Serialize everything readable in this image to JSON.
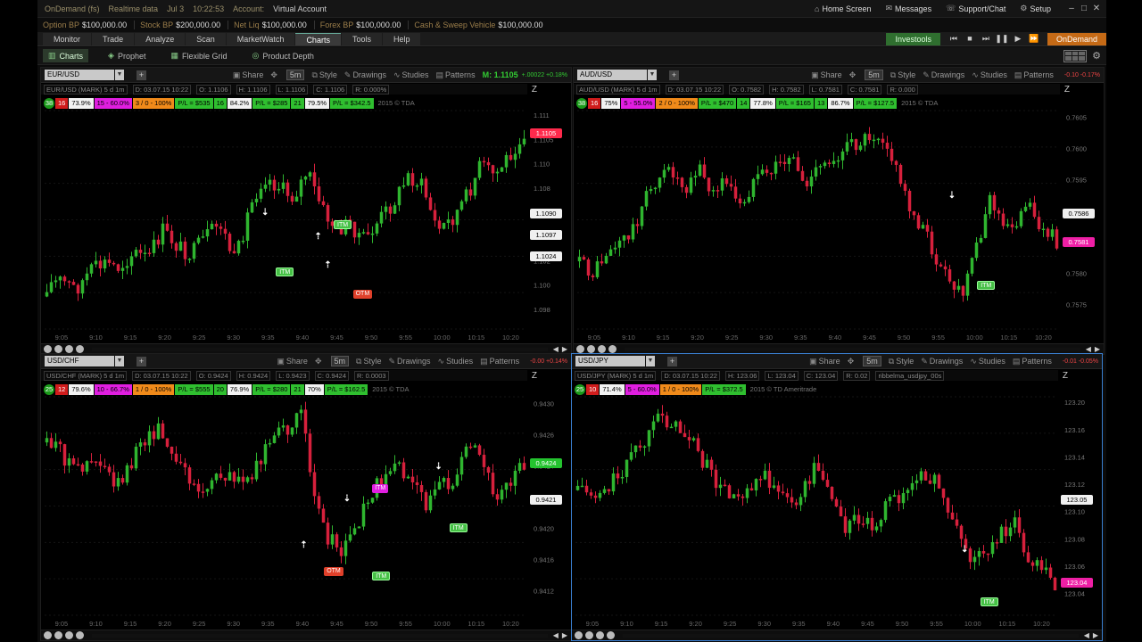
{
  "titlebar": {
    "app": "OnDemand (fs)",
    "data_mode": "Realtime data",
    "date": "Jul 3",
    "time": "10:22:53",
    "account_label": "Account:",
    "account": "Virtual Account",
    "home": "Home Screen",
    "messages": "Messages",
    "support": "Support/Chat",
    "setup": "Setup"
  },
  "account_bar": [
    {
      "label": "Option BP",
      "value": "$100,000.00"
    },
    {
      "label": "Stock BP",
      "value": "$200,000.00"
    },
    {
      "label": "Net Liq",
      "value": "$100,000.00"
    },
    {
      "label": "Forex BP",
      "value": "$100,000.00"
    },
    {
      "label": "Cash & Sweep Vehicle",
      "value": "$100,000.00"
    }
  ],
  "nav": {
    "tabs": [
      "Monitor",
      "Trade",
      "Analyze",
      "Scan",
      "MarketWatch",
      "Charts",
      "Tools",
      "Help"
    ],
    "active": "Charts",
    "live_label": "Investools",
    "ondemand_label": "OnDemand"
  },
  "subnav": [
    "Charts",
    "Prophet",
    "Flexible Grid",
    "Product Depth"
  ],
  "panel_tools": {
    "share": "Share",
    "style": "Style",
    "drawings": "Drawings",
    "studies": "Studies",
    "patterns": "Patterns",
    "period": "5m"
  },
  "panels": [
    {
      "symbol": "EUR/USD",
      "quote": "M: 1.1105",
      "quote_color": "green",
      "change": "+.00022 +0.18%",
      "info": [
        "EUR/USD (MARK) 5 d 1m",
        "D: 03.07.15 10:22",
        "O: 1.1106",
        "H: 1.1106",
        "L: 1.1106",
        "C: 1.1106",
        "R: 0.000%"
      ],
      "strip": [
        {
          "t": "38",
          "c": "g"
        },
        {
          "t": "16",
          "c": "r"
        },
        {
          "t": "73.9%",
          "c": "w"
        },
        {
          "t": "15 - 60.0%",
          "c": "m"
        },
        {
          "t": "3 / 0 - 100%",
          "c": "o"
        },
        {
          "t": "P/L = $535",
          "c": "g"
        },
        {
          "t": "16",
          "c": "g"
        },
        {
          "t": "84.2%",
          "c": "w"
        },
        {
          "t": "P/L = $285",
          "c": "g"
        },
        {
          "t": "21",
          "c": "g"
        },
        {
          "t": "79.5%",
          "c": "w"
        },
        {
          "t": "P/L = $342.5",
          "c": "g"
        }
      ],
      "note": "2015 © TDA",
      "price_tag": "1.1105",
      "levels": [
        "1.1090",
        "1.1097",
        "1.1024"
      ],
      "axis": [
        "1.111",
        "1.1105",
        "1.110",
        "1.108",
        "1.106",
        "1.104",
        "1.102",
        "1.100",
        "1.098"
      ],
      "times": [
        "9:05",
        "9:10",
        "9:15",
        "9:20",
        "9:25",
        "9:30",
        "9:35",
        "9:40",
        "9:45",
        "9:50",
        "9:55",
        "10:00",
        "10:15",
        "10:20"
      ]
    },
    {
      "symbol": "AUD/USD",
      "quote": "",
      "quote_color": "red",
      "change": "-0.10 -0.17%",
      "info": [
        "AUD/USD (MARK) 5 d 1m",
        "D: 03.07.15 10:22",
        "O: 0.7582",
        "H: 0.7582",
        "L: 0.7581",
        "C: 0.7581",
        "R: 0.000"
      ],
      "strip": [
        {
          "t": "38",
          "c": "g"
        },
        {
          "t": "16",
          "c": "r"
        },
        {
          "t": "75%",
          "c": "w"
        },
        {
          "t": "5 - 55.0%",
          "c": "m"
        },
        {
          "t": "2 / 0 - 100%",
          "c": "o"
        },
        {
          "t": "P/L = $470",
          "c": "g"
        },
        {
          "t": "14",
          "c": "g"
        },
        {
          "t": "77.8%",
          "c": "w"
        },
        {
          "t": "P/L = $165",
          "c": "g"
        },
        {
          "t": "13",
          "c": "g"
        },
        {
          "t": "86.7%",
          "c": "w"
        },
        {
          "t": "P/L = $127.5",
          "c": "g"
        }
      ],
      "note": "2015 © TDA",
      "price_tag": "0.7581",
      "levels": [
        "0.7586"
      ],
      "axis": [
        "0.7605",
        "0.7600",
        "0.7595",
        "0.7590",
        "0.7585",
        "0.7580",
        "0.7575"
      ],
      "times": [
        "9:05",
        "9:10",
        "9:15",
        "9:20",
        "9:25",
        "9:30",
        "9:35",
        "9:40",
        "9:45",
        "9:50",
        "9:55",
        "10:00",
        "10:15",
        "10:20"
      ]
    },
    {
      "symbol": "USD/CHF",
      "quote": "",
      "quote_color": "red",
      "change": "-0.00 +0.14%",
      "info": [
        "USD/CHF (MARK) 5 d 1m",
        "D: 03.07.15 10:22",
        "O: 0.9424",
        "H: 0.9424",
        "L: 0.9423",
        "C: 0.9424",
        "R: 0.0003"
      ],
      "strip": [
        {
          "t": "25",
          "c": "g"
        },
        {
          "t": "12",
          "c": "r"
        },
        {
          "t": "79.6%",
          "c": "w"
        },
        {
          "t": "10 - 66.7%",
          "c": "m"
        },
        {
          "t": "1 / 0 - 100%",
          "c": "o"
        },
        {
          "t": "P/L = $555",
          "c": "g"
        },
        {
          "t": "20",
          "c": "g"
        },
        {
          "t": "76.9%",
          "c": "w"
        },
        {
          "t": "P/L = $280",
          "c": "g"
        },
        {
          "t": "21",
          "c": "g"
        },
        {
          "t": "70%",
          "c": "w"
        },
        {
          "t": "P/L = $162.5",
          "c": "g"
        }
      ],
      "note": "2015 © TDA",
      "price_tag": "0.9424",
      "levels": [
        "0.9421"
      ],
      "axis": [
        "0.9430",
        "0.9426",
        "0.9424",
        "0.9422",
        "0.9420",
        "0.9416",
        "0.9412"
      ],
      "times": [
        "9:05",
        "9:10",
        "9:15",
        "9:20",
        "9:25",
        "9:30",
        "9:35",
        "9:40",
        "9:45",
        "9:50",
        "9:55",
        "10:00",
        "10:15",
        "10:20"
      ]
    },
    {
      "symbol": "USD/JPY",
      "quote": "",
      "quote_color": "red",
      "change": "-0.01 -0.05%",
      "info": [
        "USD/JPY (MARK) 5 d 1m",
        "D: 03.07.15 10:22",
        "H: 123.06",
        "L: 123.04",
        "C: 123.04",
        "R: 0.02",
        "ribbelma_usdjpy_00s"
      ],
      "strip": [
        {
          "t": "25",
          "c": "g"
        },
        {
          "t": "10",
          "c": "r"
        },
        {
          "t": "71.4%",
          "c": "w"
        },
        {
          "t": "5 - 60.0%",
          "c": "m"
        },
        {
          "t": "1 / 0 - 100%",
          "c": "o"
        },
        {
          "t": "P/L = $372.5",
          "c": "g"
        }
      ],
      "note": "2015 © TD Ameritrade",
      "price_tag": "123.04",
      "levels": [
        "123.05"
      ],
      "axis": [
        "123.20",
        "123.16",
        "123.14",
        "123.12",
        "123.10",
        "123.08",
        "123.06",
        "123.04"
      ],
      "times": [
        "9:05",
        "9:10",
        "9:15",
        "9:20",
        "9:25",
        "9:30",
        "9:35",
        "9:40",
        "9:45",
        "9:50",
        "9:55",
        "10:00",
        "10:15",
        "10:20"
      ]
    }
  ],
  "signals": {
    "itm": "ITM",
    "otm": "OTM"
  },
  "colors": {
    "up": "#2fb52f",
    "down": "#d6203c",
    "accent": "#3a7fd0",
    "ondemand": "#c56a16"
  }
}
